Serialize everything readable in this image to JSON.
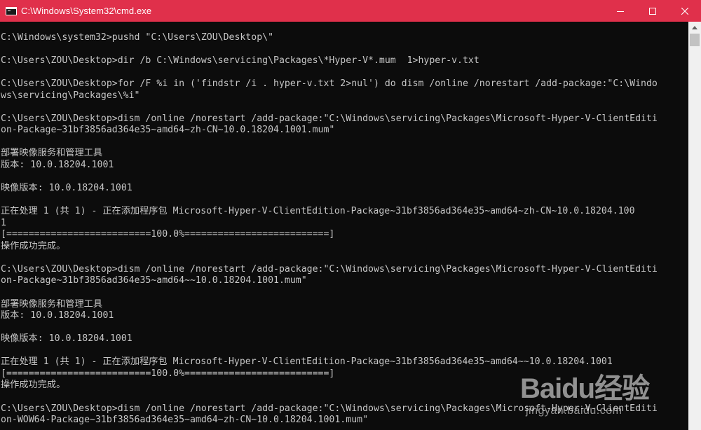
{
  "window": {
    "title": "C:\\Windows\\System32\\cmd.exe",
    "minimize_icon": "minimize-icon",
    "maximize_icon": "maximize-icon",
    "close_icon": "close-icon"
  },
  "colors": {
    "titlebar": "#e0304b",
    "console_bg": "#0c0c0c",
    "console_text": "#c6c6c6"
  },
  "console": {
    "lines": [
      "C:\\Windows\\system32>pushd \"C:\\Users\\ZOU\\Desktop\\\"",
      "",
      "C:\\Users\\ZOU\\Desktop>dir /b C:\\Windows\\servicing\\Packages\\*Hyper-V*.mum  1>hyper-v.txt",
      "",
      "C:\\Users\\ZOU\\Desktop>for /F %i in ('findstr /i . hyper-v.txt 2>nul') do dism /online /norestart /add-package:\"C:\\Windo",
      "ws\\servicing\\Packages\\%i\"",
      "",
      "C:\\Users\\ZOU\\Desktop>dism /online /norestart /add-package:\"C:\\Windows\\servicing\\Packages\\Microsoft-Hyper-V-ClientEditi",
      "on-Package~31bf3856ad364e35~amd64~zh-CN~10.0.18204.1001.mum\"",
      "",
      "部署映像服务和管理工具",
      "版本: 10.0.18204.1001",
      "",
      "映像版本: 10.0.18204.1001",
      "",
      "正在处理 1 (共 1) - 正在添加程序包 Microsoft-Hyper-V-ClientEdition-Package~31bf3856ad364e35~amd64~zh-CN~10.0.18204.100",
      "1",
      "[==========================100.0%==========================]",
      "操作成功完成。",
      "",
      "C:\\Users\\ZOU\\Desktop>dism /online /norestart /add-package:\"C:\\Windows\\servicing\\Packages\\Microsoft-Hyper-V-ClientEditi",
      "on-Package~31bf3856ad364e35~amd64~~10.0.18204.1001.mum\"",
      "",
      "部署映像服务和管理工具",
      "版本: 10.0.18204.1001",
      "",
      "映像版本: 10.0.18204.1001",
      "",
      "正在处理 1 (共 1) - 正在添加程序包 Microsoft-Hyper-V-ClientEdition-Package~31bf3856ad364e35~amd64~~10.0.18204.1001",
      "[==========================100.0%==========================]",
      "操作成功完成。",
      "",
      "C:\\Users\\ZOU\\Desktop>dism /online /norestart /add-package:\"C:\\Windows\\servicing\\Packages\\Microsoft-Hyper-V-ClientEditi",
      "on-WOW64-Package~31bf3856ad364e35~amd64~zh-CN~10.0.18204.1001.mum\""
    ]
  },
  "watermark": {
    "brand": "Baidu经验",
    "url": "jingyan.baidu.com"
  }
}
